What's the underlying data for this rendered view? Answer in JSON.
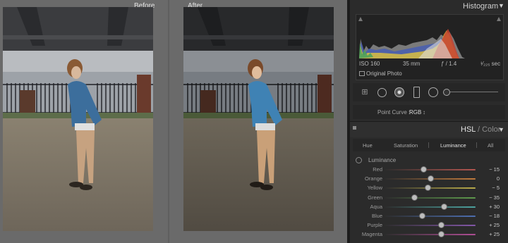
{
  "compare": {
    "before_label": "Before",
    "after_label": "After"
  },
  "histogram": {
    "title": "Histogram",
    "iso": "ISO 160",
    "focal_length": "35 mm",
    "aperture": "ƒ / 1.4",
    "shutter": "¹⁄₂₂₅ sec",
    "original_photo_label": "Original Photo"
  },
  "point_curve": {
    "label": "Point Curve :",
    "value": "RGB",
    "chevron": "↕"
  },
  "hsl": {
    "title_hsl": "HSL",
    "title_sep": " / ",
    "title_color": "Color",
    "tabs": [
      "Hue",
      "Saturation",
      "Luminance",
      "All"
    ],
    "active_tab": "Luminance",
    "section_label": "Luminance",
    "sliders": [
      {
        "label": "Red",
        "value": "− 15",
        "pos": 0.42,
        "track": "#b2554f"
      },
      {
        "label": "Orange",
        "value": "0",
        "pos": 0.5,
        "track": "#c07a3d"
      },
      {
        "label": "Yellow",
        "value": "− 5",
        "pos": 0.47,
        "track": "#b9ab49"
      },
      {
        "label": "Green",
        "value": "− 35",
        "pos": 0.32,
        "track": "#5e9a4c"
      },
      {
        "label": "Aqua",
        "value": "+ 30",
        "pos": 0.65,
        "track": "#4ca3a0"
      },
      {
        "label": "Blue",
        "value": "− 18",
        "pos": 0.41,
        "track": "#4d6eb0"
      },
      {
        "label": "Purple",
        "value": "+ 25",
        "pos": 0.62,
        "track": "#8357a8"
      },
      {
        "label": "Magenta",
        "value": "+ 25",
        "pos": 0.62,
        "track": "#ae4d93"
      }
    ]
  },
  "icons": [
    "crop-icon",
    "spot-removal-icon",
    "red-eye-icon",
    "graduated-filter-icon",
    "radial-filter-icon",
    "adjustment-brush-icon"
  ]
}
